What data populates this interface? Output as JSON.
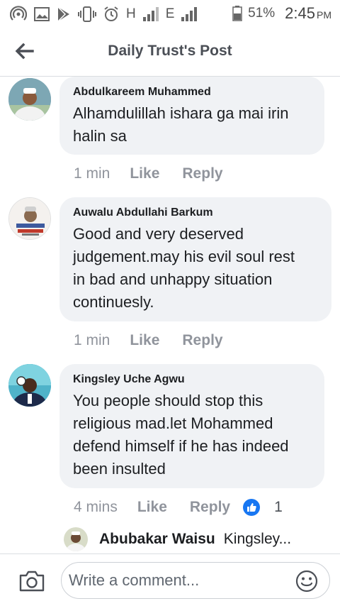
{
  "status_bar": {
    "network_h": "H",
    "network_e": "E",
    "battery": "51%",
    "time": "2:45",
    "ampm": "PM",
    "icons": [
      "hotspot-icon",
      "gallery-icon",
      "play-store-icon",
      "vibrate-icon",
      "alarm-icon",
      "signal-icon",
      "signal-icon",
      "battery-icon"
    ]
  },
  "header": {
    "title": "Daily Trust's Post",
    "back_icon": "arrow-left-icon"
  },
  "comments": [
    {
      "author": "Abdulkareem Muhammed",
      "text_lines": [
        "Alhamdulillah ishara ga mai irin",
        "halin sa"
      ],
      "time": "1 min",
      "like_label": "Like",
      "reply_label": "Reply"
    },
    {
      "author": "Auwalu Abdullahi Barkum",
      "text_lines": [
        "Good and very deserved",
        "judgement.may his evil soul rest",
        "in bad and unhappy situation",
        "continuesly."
      ],
      "time": "1 min",
      "like_label": "Like",
      "reply_label": "Reply"
    },
    {
      "author": "Kingsley Uche Agwu",
      "text_lines": [
        "You people should stop this",
        "religious mad.let Mohammed",
        "defend himself if he has indeed",
        "been insulted"
      ],
      "time": "4 mins",
      "like_label": "Like",
      "reply_label": "Reply",
      "reaction_icon": "like-icon",
      "reaction_count": "1"
    }
  ],
  "reply_preview": {
    "author": "Abubakar Waisu",
    "snippet": "Kingsley..."
  },
  "composer": {
    "placeholder": "Write a comment...",
    "camera_icon": "camera-icon",
    "emoji_icon": "emoji-icon"
  },
  "colors": {
    "bubble": "#f0f2f5",
    "meta_gray": "#90949c",
    "like_blue": "#1877f2",
    "title_gray": "#4b4f56"
  }
}
